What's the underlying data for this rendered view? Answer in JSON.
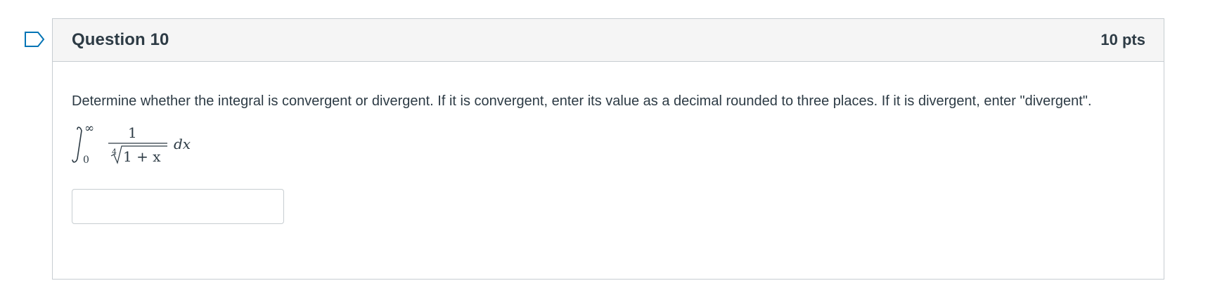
{
  "question": {
    "title": "Question 10",
    "points": "10 pts",
    "text": "Determine whether the integral is convergent or divergent. If it is convergent, enter its value as a decimal rounded to three places. If it is divergent, enter \"divergent\".",
    "formula": {
      "upper_limit": "∞",
      "lower_limit": "0",
      "numerator": "1",
      "root_index": "4",
      "radicand": "1 + x",
      "differential": "dx"
    },
    "answer": {
      "value": "",
      "placeholder": ""
    }
  },
  "colors": {
    "header_bg": "#f5f5f5",
    "border": "#c7cdd1",
    "text": "#2d3b45",
    "flag": "#0374b5"
  },
  "icons": {
    "flag": "bookmark-flag-icon"
  }
}
